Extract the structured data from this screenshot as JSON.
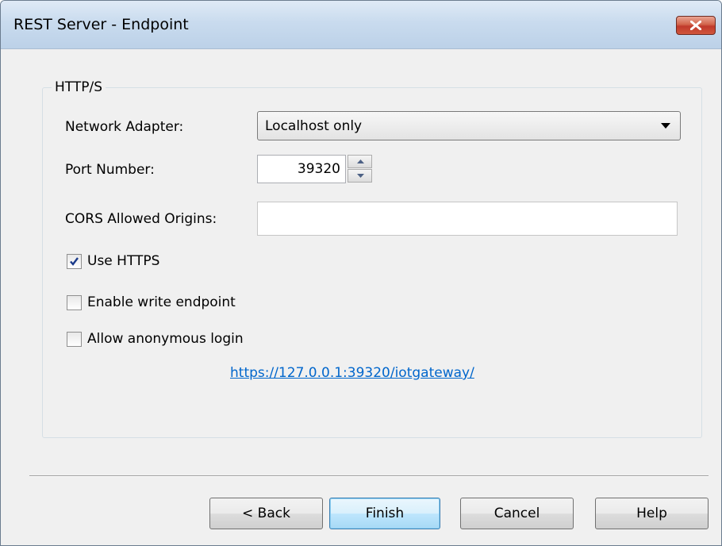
{
  "window": {
    "title": "REST Server - Endpoint"
  },
  "group": {
    "title": "HTTP/S"
  },
  "fields": {
    "network_adapter_label": "Network Adapter:",
    "network_adapter_value": "Localhost only",
    "port_label": "Port Number:",
    "port_value": "39320",
    "cors_label": "CORS Allowed Origins:",
    "cors_value": ""
  },
  "checkboxes": [
    {
      "label": "Use HTTPS",
      "checked": true
    },
    {
      "label": "Enable write endpoint",
      "checked": false
    },
    {
      "label": "Allow anonymous login",
      "checked": false
    }
  ],
  "link": {
    "text": "https://127.0.0.1:39320/iotgateway/"
  },
  "buttons": {
    "back": "< Back",
    "finish": "Finish",
    "cancel": "Cancel",
    "help": "Help"
  },
  "icons": {
    "close": "close-icon",
    "dropdown": "chevron-down-icon",
    "spin_up": "arrow-up-icon",
    "spin_down": "arrow-down-icon",
    "check": "checkmark-icon"
  }
}
